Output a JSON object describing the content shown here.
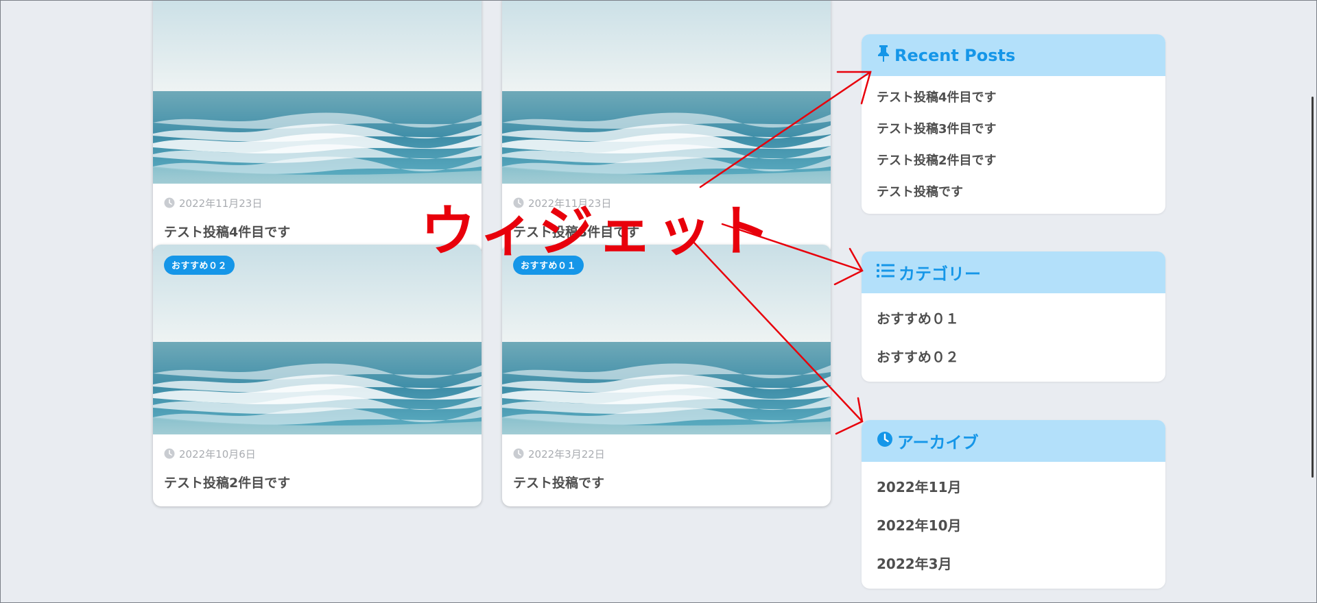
{
  "posts": [
    {
      "date": "2022年11月23日",
      "title": "テスト投稿4件目です",
      "badge": ""
    },
    {
      "date": "2022年11月23日",
      "title": "テスト投稿3件目です",
      "badge": ""
    },
    {
      "date": "2022年10月6日",
      "title": "テスト投稿2件目です",
      "badge": "おすすめ０２"
    },
    {
      "date": "2022年3月22日",
      "title": "テスト投稿です",
      "badge": "おすすめ０１"
    }
  ],
  "widgets": {
    "recent": {
      "title": "Recent Posts",
      "icon": "pin-icon",
      "items": [
        "テスト投稿4件目です",
        "テスト投稿3件目です",
        "テスト投稿2件目です",
        "テスト投稿です"
      ]
    },
    "category": {
      "title": "カテゴリー",
      "icon": "list-icon",
      "items": [
        "おすすめ０１",
        "おすすめ０２"
      ]
    },
    "archive": {
      "title": "アーカイブ",
      "icon": "clock-icon",
      "items": [
        "2022年11月",
        "2022年10月",
        "2022年3月"
      ]
    }
  },
  "annotation": {
    "text": "ウィジェット",
    "color": "#e8000b"
  },
  "colors": {
    "accent": "#1596e8",
    "widget_header_bg": "#b3e0fa",
    "page_bg": "#e9ecf1",
    "badge_bg": "#1596e8"
  }
}
